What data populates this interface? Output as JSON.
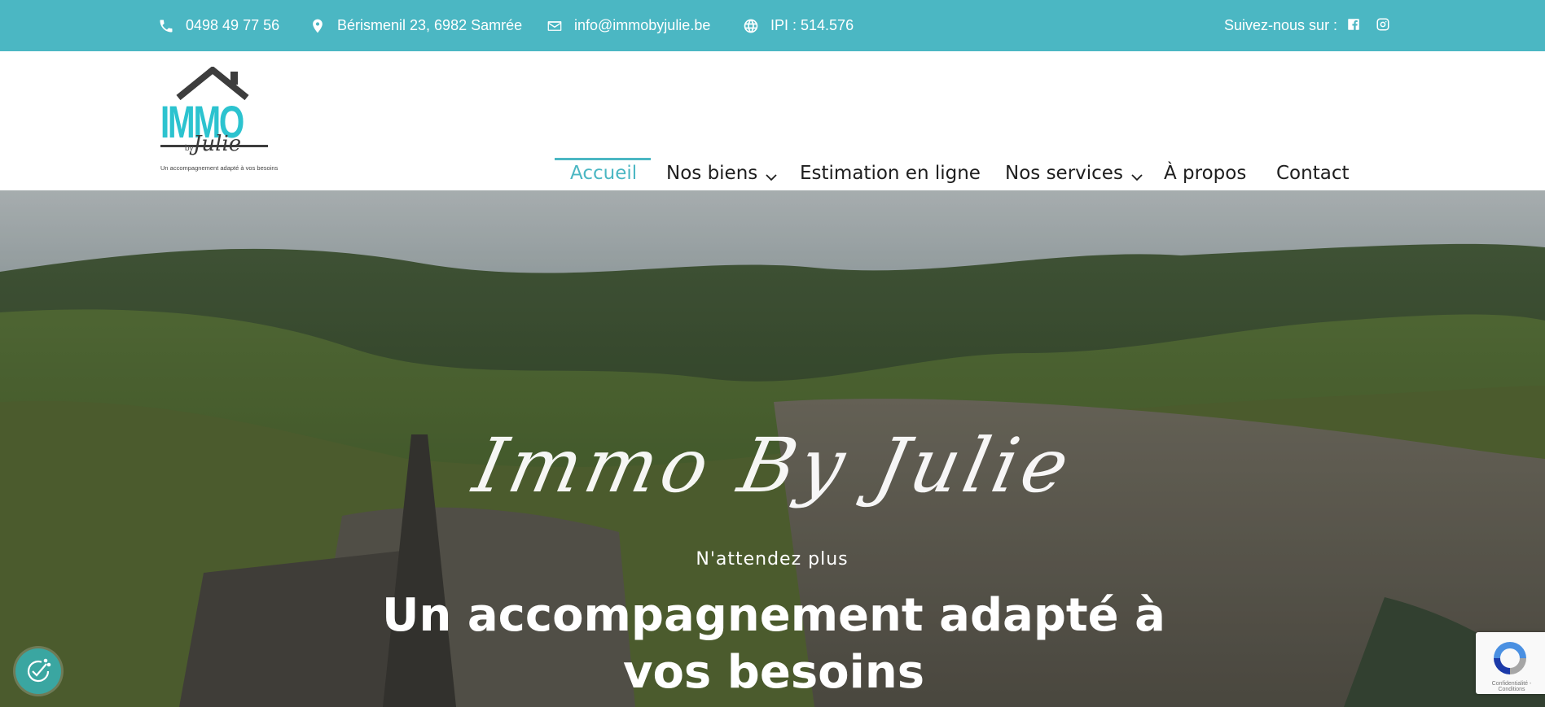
{
  "topbar": {
    "phone": "0498 49 77 56",
    "address": "Bérismenil 23, 6982 Samrée",
    "email": "info@immobyjulie.be",
    "ipi": "IPI : 514.576",
    "follow_label": "Suivez-nous sur :",
    "icons": [
      "phone-icon",
      "map-pin-icon",
      "envelope-icon",
      "globe-icon",
      "facebook-icon",
      "instagram-icon"
    ]
  },
  "logo": {
    "word": "IMMO",
    "by": "by",
    "name": "Julie",
    "tagline": "Un accompagnement adapté à vos besoins"
  },
  "nav": {
    "items": [
      {
        "label": "Accueil",
        "active": true
      },
      {
        "label": "Nos biens",
        "has_dropdown": true
      },
      {
        "label": "Estimation en ligne"
      },
      {
        "label": "Nos services",
        "has_dropdown": true
      },
      {
        "label": "À propos"
      },
      {
        "label": "Contact"
      }
    ]
  },
  "hero": {
    "script_title": "Immo By Julie",
    "kicker": "N'attendez plus",
    "heading": "Un accompagnement adapté à vos besoins"
  },
  "widgets": {
    "recaptcha_text": "Confidentialité - Conditions"
  },
  "colors": {
    "accent": "#4bb7c3",
    "logo_teal": "#2cc3cf",
    "nav_text": "#1e1e1e",
    "cookie_button": "#3aa6a1"
  }
}
